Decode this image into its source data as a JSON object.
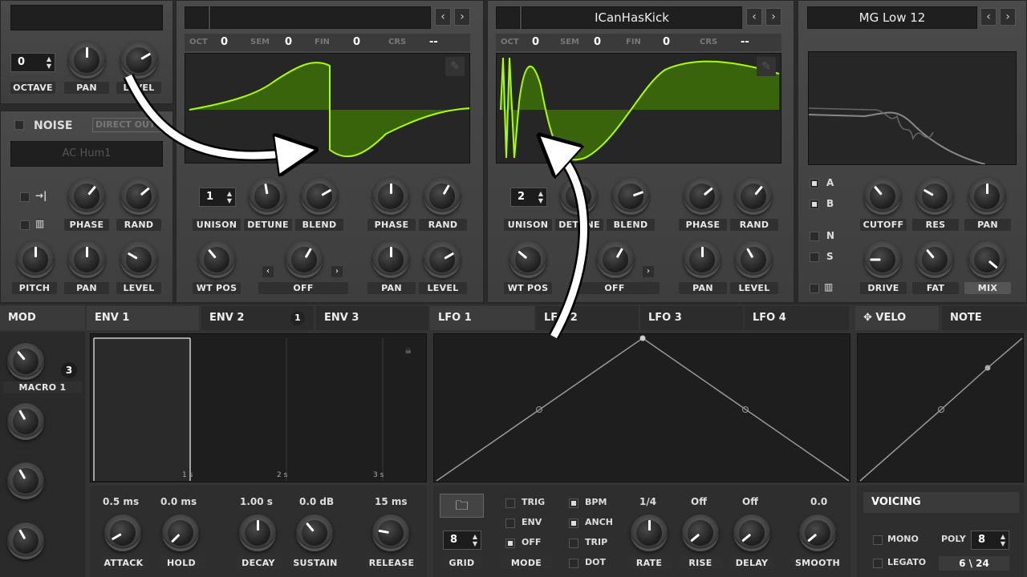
{
  "osc_left": {
    "octave_value": "0",
    "octave_label": "OCTAVE",
    "pan_label": "PAN",
    "level_label": "LEVEL"
  },
  "noise": {
    "label": "NOISE",
    "direct_out": "DIRECT OUT",
    "sample": "AC Hum1",
    "phase_label": "PHASE",
    "rand_label": "RAND",
    "pitch_label": "PITCH",
    "pan_label": "PAN",
    "level_label": "LEVEL"
  },
  "osc_a": {
    "oct_label": "OCT",
    "oct": "0",
    "sem_label": "SEM",
    "sem": "0",
    "fin_label": "FIN",
    "fin": "0",
    "crs_label": "CRS",
    "crs": "--",
    "unison_value": "1",
    "unison_label": "UNISON",
    "detune_label": "DETUNE",
    "blend_label": "BLEND",
    "phase_label": "PHASE",
    "rand_label": "RAND",
    "wtpos_label": "WT POS",
    "warp_value": "OFF",
    "pan_label": "PAN",
    "level_label": "LEVEL"
  },
  "osc_b": {
    "wavetable": "ICanHasKick",
    "oct_label": "OCT",
    "oct": "0",
    "sem_label": "SEM",
    "sem": "0",
    "fin_label": "FIN",
    "fin": "0",
    "crs_label": "CRS",
    "crs": "--",
    "unison_value": "2",
    "unison_label": "UNISON",
    "detune_label": "DETUNE",
    "blend_label": "BLEND",
    "phase_label": "PHASE",
    "rand_label": "RAND",
    "wtpos_label": "WT POS",
    "warp_value": "OFF",
    "pan_label": "PAN",
    "level_label": "LEVEL"
  },
  "filter": {
    "type": "MG Low 12",
    "a": "A",
    "b": "B",
    "n": "N",
    "s": "S",
    "cutoff_label": "CUTOFF",
    "res_label": "RES",
    "pan_label": "PAN",
    "drive_label": "DRIVE",
    "fat_label": "FAT",
    "mix_label": "MIX"
  },
  "tabs": {
    "mod": "MOD",
    "env1": "ENV 1",
    "env2": "ENV 2",
    "env2_badge": "1",
    "env3": "ENV 3",
    "lfo1": "LFO 1",
    "lfo2": "LFO 2",
    "lfo3": "LFO 3",
    "lfo4": "LFO 4",
    "velo": "VELO",
    "note": "NOTE"
  },
  "macro": {
    "badge": "3",
    "label": "MACRO 1"
  },
  "env": {
    "time_1": "1 s",
    "time_2": "2 s",
    "time_3": "3 s",
    "attack_value": "0.5 ms",
    "attack_label": "ATTACK",
    "hold_value": "0.0 ms",
    "hold_label": "HOLD",
    "decay_value": "1.00 s",
    "decay_label": "DECAY",
    "sustain_value": "0.0 dB",
    "sustain_label": "SUSTAIN",
    "release_value": "15 ms",
    "release_label": "RELEASE"
  },
  "lfo": {
    "grid_value": "8",
    "grid_label": "GRID",
    "trig": "TRIG",
    "env": "ENV",
    "off": "OFF",
    "mode_label": "MODE",
    "bpm": "BPM",
    "anch": "ANCH",
    "trip": "TRIP",
    "dot": "DOT",
    "rate_value": "1/4",
    "rate_label": "RATE",
    "rise_value": "Off",
    "rise_label": "RISE",
    "delay_value": "Off",
    "delay_label": "DELAY",
    "smooth_value": "0.0",
    "smooth_label": "SMOOTH"
  },
  "voicing": {
    "title": "VOICING",
    "mono": "MONO",
    "legato": "LEGATO",
    "poly_label": "POLY",
    "poly_value": "8",
    "voices": "6 \\ 24"
  },
  "colors": {
    "wave": "#a8ff00",
    "wave_fill": "#3d6b0a",
    "panel": "#454545",
    "dark": "#1f1f1f"
  }
}
